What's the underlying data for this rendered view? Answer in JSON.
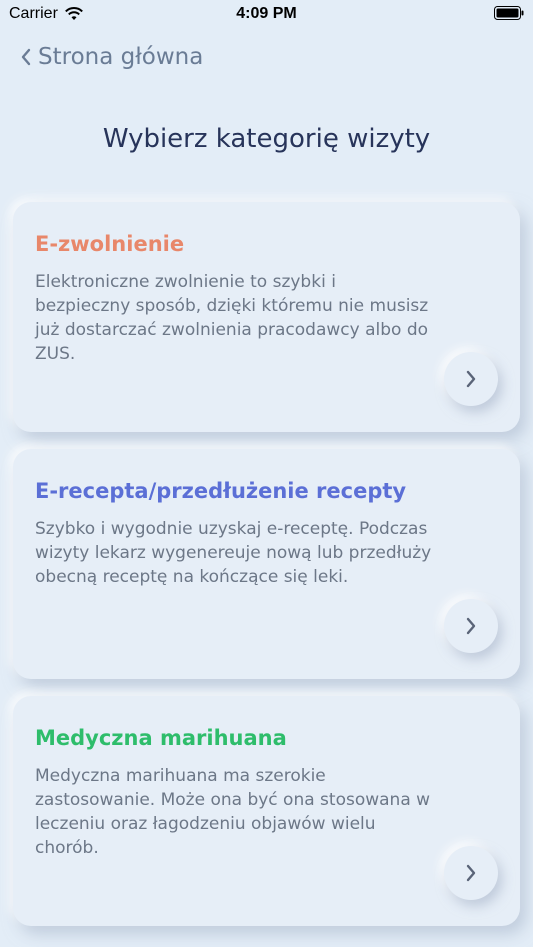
{
  "status_bar": {
    "carrier": "Carrier",
    "time": "4:09 PM"
  },
  "nav": {
    "back_label": "Strona główna"
  },
  "page": {
    "title": "Wybierz kategorię wizyty"
  },
  "categories": [
    {
      "title": "E-zwolnienie",
      "color": "#e8876a",
      "description": "Elektroniczne zwolnienie to szybki i bezpieczny sposób, dzięki któremu nie musisz już dostarczać zwolnienia pracodawcy albo do ZUS."
    },
    {
      "title": "E-recepta/przedłużenie recepty",
      "color": "#5b6fd6",
      "description": "Szybko i wygodnie uzyskaj e-receptę. Podczas wizyty lekarz wygenereuje nową lub przedłuży obecną receptę na kończące się leki."
    },
    {
      "title": "Medyczna marihuana",
      "color": "#2ebd6b",
      "description": "Medyczna marihuana ma szerokie zastosowanie. Może ona być ona stosowana w leczeniu oraz łagodzeniu objawów wielu chorób."
    }
  ],
  "icons": {
    "back": "chevron-left-icon",
    "arrow": "chevron-right-icon",
    "wifi": "wifi-icon",
    "battery": "battery-icon"
  }
}
